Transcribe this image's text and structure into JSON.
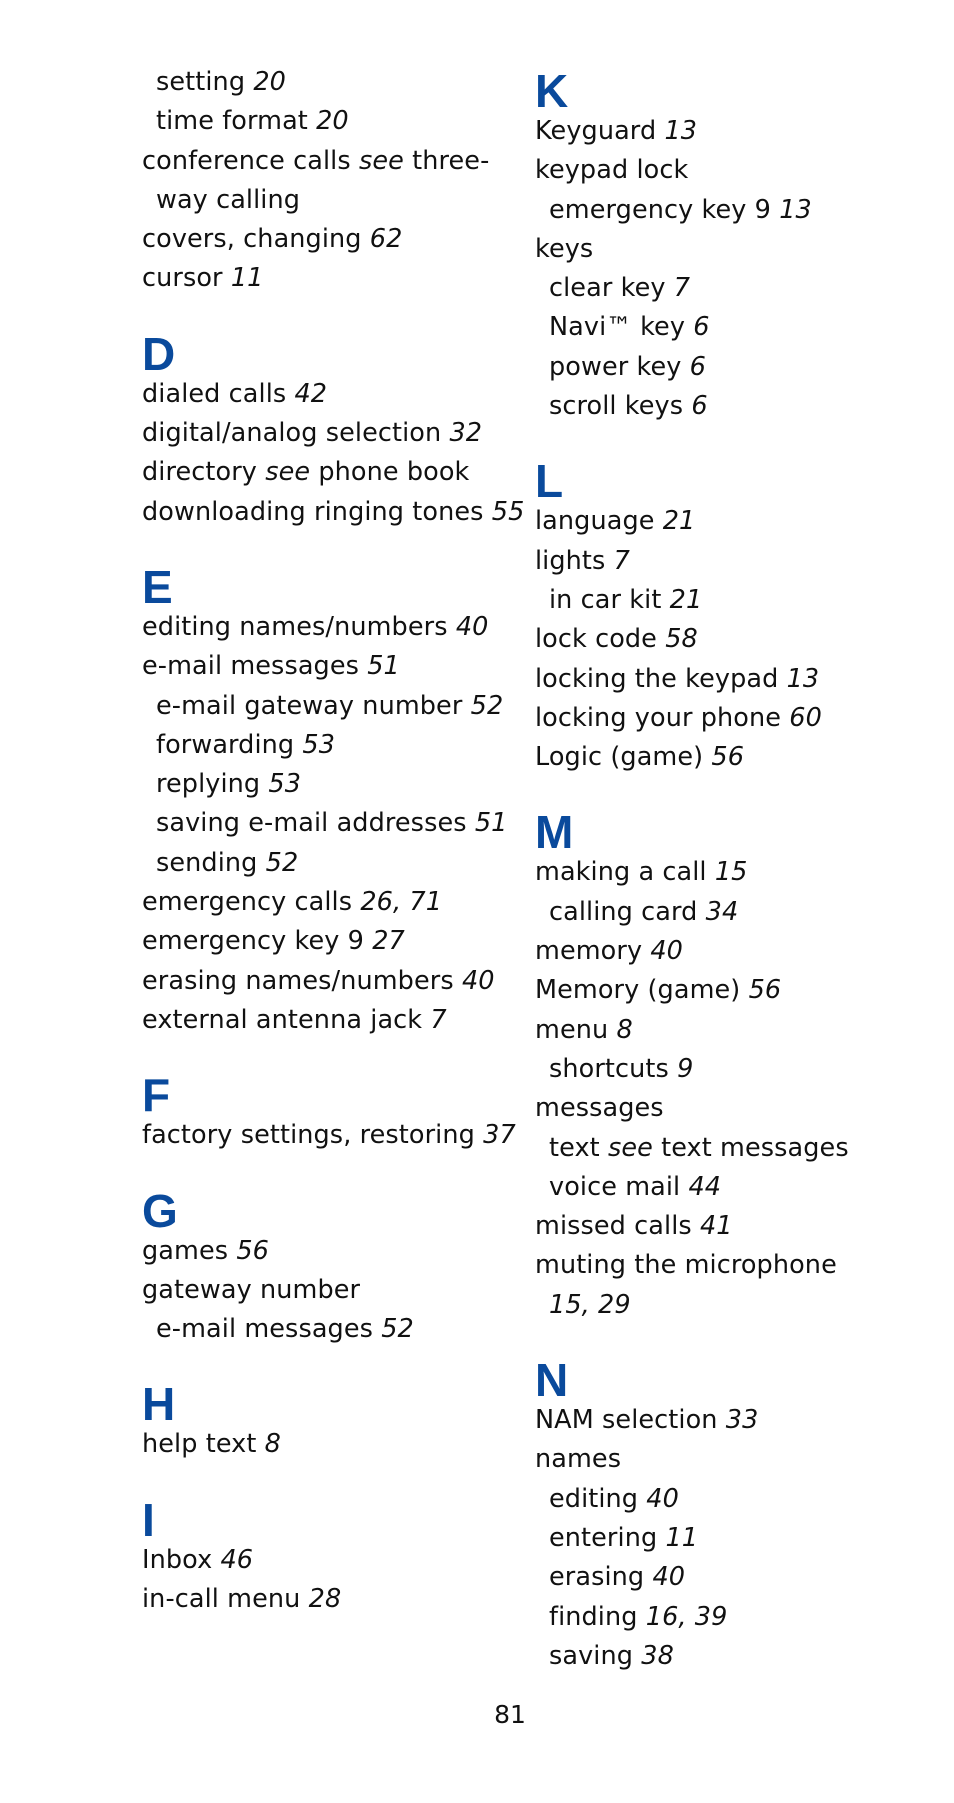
{
  "page_number": "81",
  "accent_color": "#0a4a9c",
  "left_column": {
    "continuation": [
      {
        "text": "setting ",
        "pages": "20",
        "sub": true
      },
      {
        "text": "time format ",
        "pages": "20",
        "sub": true
      },
      {
        "text": "conference calls ",
        "see": "see",
        "after": " three-",
        "sub": false
      },
      {
        "text": "way calling",
        "sub": true
      },
      {
        "text": "covers, changing ",
        "pages": "62",
        "sub": false
      },
      {
        "text": "cursor ",
        "pages": "11",
        "sub": false
      }
    ],
    "sections": [
      {
        "letter": "D",
        "entries": [
          {
            "text": "dialed calls ",
            "pages": "42",
            "sub": false
          },
          {
            "text": "digital/analog selection ",
            "pages": "32",
            "sub": false
          },
          {
            "text": "directory ",
            "see": "see",
            "after": " phone book",
            "sub": false
          },
          {
            "text": "downloading ringing tones ",
            "pages": "55",
            "sub": false
          }
        ]
      },
      {
        "letter": "E",
        "entries": [
          {
            "text": "editing names/numbers ",
            "pages": "40",
            "sub": false
          },
          {
            "text": "e-mail messages ",
            "pages": "51",
            "sub": false
          },
          {
            "text": "e-mail gateway number ",
            "pages": "52",
            "sub": true
          },
          {
            "text": "forwarding ",
            "pages": "53",
            "sub": true
          },
          {
            "text": "replying ",
            "pages": "53",
            "sub": true
          },
          {
            "text": "saving e-mail addresses ",
            "pages": "51",
            "sub": true
          },
          {
            "text": "sending ",
            "pages": "52",
            "sub": true
          },
          {
            "text": "emergency calls ",
            "pages": "26, 71",
            "sub": false
          },
          {
            "text": "emergency key 9 ",
            "pages": "27",
            "sub": false
          },
          {
            "text": "erasing names/numbers ",
            "pages": "40",
            "sub": false
          },
          {
            "text": "external antenna jack ",
            "pages": "7",
            "sub": false
          }
        ]
      },
      {
        "letter": "F",
        "entries": [
          {
            "text": "factory settings, restoring ",
            "pages": "37",
            "sub": false
          }
        ]
      },
      {
        "letter": "G",
        "entries": [
          {
            "text": "games ",
            "pages": "56",
            "sub": false
          },
          {
            "text": "gateway number",
            "sub": false
          },
          {
            "text": "e-mail messages ",
            "pages": "52",
            "sub": true
          }
        ]
      },
      {
        "letter": "H",
        "entries": [
          {
            "text": "help text ",
            "pages": "8",
            "sub": false
          }
        ]
      },
      {
        "letter": "I",
        "entries": [
          {
            "text": "Inbox ",
            "pages": "46",
            "sub": false
          },
          {
            "text": "in-call menu ",
            "pages": "28",
            "sub": false
          }
        ]
      }
    ]
  },
  "right_column": {
    "sections": [
      {
        "letter": "K",
        "entries": [
          {
            "text": "Keyguard ",
            "pages": "13",
            "sub": false
          },
          {
            "text": "keypad lock",
            "sub": false
          },
          {
            "text": "emergency key 9 ",
            "pages": "13",
            "sub": true
          },
          {
            "text": "keys",
            "sub": false
          },
          {
            "text": "clear key ",
            "pages": "7",
            "sub": true
          },
          {
            "text": "Navi™ key ",
            "pages": "6",
            "sub": true
          },
          {
            "text": "power key ",
            "pages": "6",
            "sub": true
          },
          {
            "text": "scroll keys ",
            "pages": "6",
            "sub": true
          }
        ]
      },
      {
        "letter": "L",
        "entries": [
          {
            "text": "language ",
            "pages": "21",
            "sub": false
          },
          {
            "text": "lights ",
            "pages": "7",
            "sub": false
          },
          {
            "text": "in car kit ",
            "pages": "21",
            "sub": true
          },
          {
            "text": "lock code ",
            "pages": "58",
            "sub": false
          },
          {
            "text": "locking the keypad ",
            "pages": "13",
            "sub": false
          },
          {
            "text": "locking your phone ",
            "pages": "60",
            "sub": false
          },
          {
            "text": "Logic (game) ",
            "pages": "56",
            "sub": false
          }
        ]
      },
      {
        "letter": "M",
        "entries": [
          {
            "text": "making a call ",
            "pages": "15",
            "sub": false
          },
          {
            "text": "calling card ",
            "pages": "34",
            "sub": true
          },
          {
            "text": "memory ",
            "pages": "40",
            "sub": false
          },
          {
            "text": "Memory (game) ",
            "pages": "56",
            "sub": false
          },
          {
            "text": "menu ",
            "pages": "8",
            "sub": false
          },
          {
            "text": "shortcuts ",
            "pages": "9",
            "sub": true
          },
          {
            "text": "messages",
            "sub": false
          },
          {
            "text": "text ",
            "see": "see",
            "after": " text messages",
            "sub": true
          },
          {
            "text": "voice mail ",
            "pages": "44",
            "sub": true
          },
          {
            "text": "missed calls ",
            "pages": "41",
            "sub": false
          },
          {
            "text": "muting the microphone",
            "sub": false
          },
          {
            "text": "",
            "pages": "15, 29",
            "sub": true
          }
        ]
      },
      {
        "letter": "N",
        "entries": [
          {
            "text": "NAM selection ",
            "pages": "33",
            "sub": false
          },
          {
            "text": "names",
            "sub": false
          },
          {
            "text": "editing ",
            "pages": "40",
            "sub": true
          },
          {
            "text": "entering ",
            "pages": "11",
            "sub": true
          },
          {
            "text": "erasing ",
            "pages": "40",
            "sub": true
          },
          {
            "text": "finding ",
            "pages": "16, 39",
            "sub": true
          },
          {
            "text": "saving ",
            "pages": "38",
            "sub": true
          }
        ]
      }
    ]
  }
}
